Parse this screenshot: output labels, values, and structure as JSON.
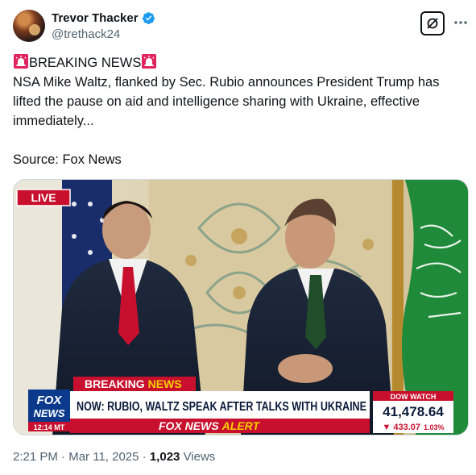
{
  "author": {
    "display_name": "Trevor Thacker",
    "handle": "@trethack24",
    "verified": true
  },
  "tweet": {
    "headline": "BREAKING NEWS",
    "body": "NSA Mike Waltz, flanked by Sec. Rubio announces President Trump has lifted the pause on aid and intelligence sharing with Ukraine, effective immediately...",
    "source_line": "Source: Fox News"
  },
  "media": {
    "live_badge": "LIVE",
    "breaking_label_1": "BREAKING",
    "breaking_label_2": "NEWS",
    "chyron": "NOW: RUBIO, WALTZ SPEAK AFTER TALKS WITH UKRAINE",
    "network_logo_1": "FOX",
    "network_logo_2": "NEWS",
    "clock": "12:14 MT",
    "alert_1": "FOX NEWS",
    "alert_2": "ALERT",
    "ticker_label": "DOW WATCH",
    "ticker_value": "41,478.64",
    "ticker_change": "▼ 433.07",
    "ticker_pct": "1.03%"
  },
  "meta": {
    "time": "2:21 PM",
    "date": "Mar 11, 2025",
    "views_count": "1,023",
    "views_label": "Views"
  },
  "colors": {
    "text_primary": "#0f1419",
    "text_secondary": "#536471",
    "verified_blue": "#1d9bf0",
    "fox_red": "#c8102e",
    "fox_blue": "#0b3a8c",
    "saudi_green": "#1f8a3a"
  }
}
